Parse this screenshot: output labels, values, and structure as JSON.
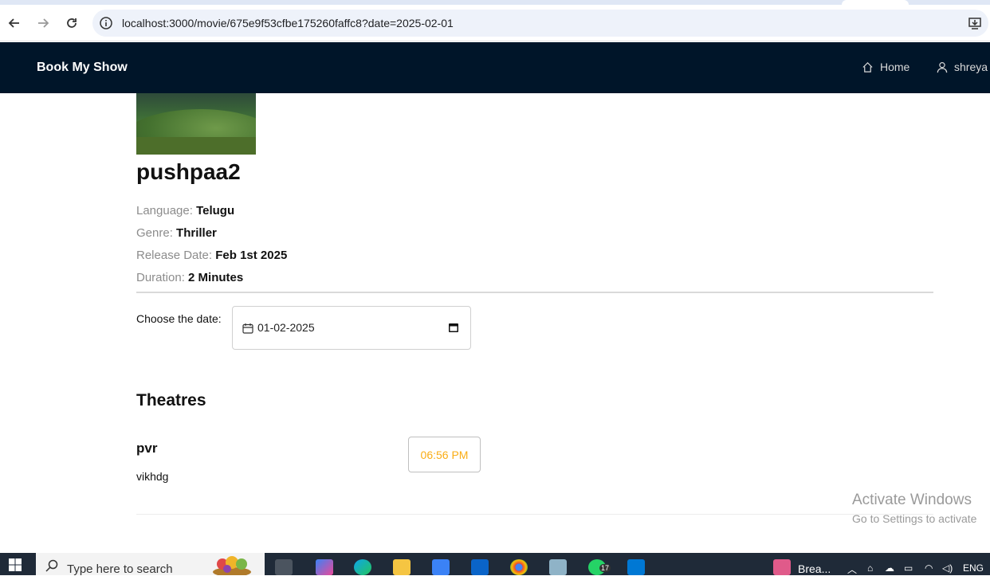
{
  "browser": {
    "url": "localhost:3000/movie/675e9f53cfbe175260faffc8?date=2025-02-01"
  },
  "header": {
    "brand": "Book My Show",
    "nav": {
      "home": "Home",
      "user": "shreya"
    }
  },
  "movie": {
    "title": "pushpaa2",
    "details": [
      {
        "label": "Language:",
        "value": "Telugu"
      },
      {
        "label": "Genre:",
        "value": "Thriller"
      },
      {
        "label": "Release Date:",
        "value": "Feb 1st 2025"
      },
      {
        "label": "Duration:",
        "value": "2 Minutes"
      }
    ]
  },
  "date_picker": {
    "label": "Choose the date:",
    "value": "01-02-2025"
  },
  "theatres": {
    "title": "Theatres",
    "items": [
      {
        "name": "pvr",
        "address": "vikhdg",
        "shows": [
          "06:56 PM"
        ]
      }
    ]
  },
  "watermark": {
    "line1": "Activate Windows",
    "line2": "Go to Settings to activate"
  },
  "taskbar": {
    "search_placeholder": "Type here to search",
    "app_label": "Brea...",
    "lang": "ENG",
    "whatsapp_badge": "17"
  },
  "colors": {
    "header_bg": "#001529",
    "show_time": "#faad14"
  }
}
